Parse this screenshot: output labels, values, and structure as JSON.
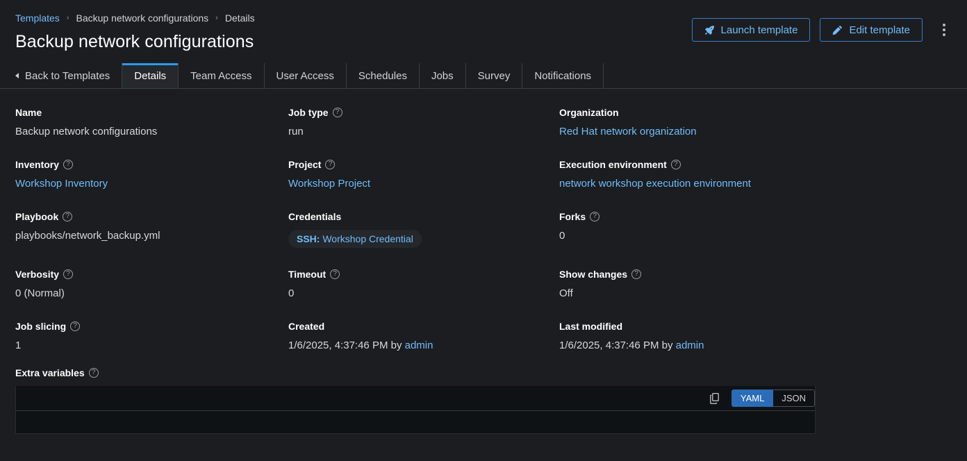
{
  "breadcrumb": {
    "items": [
      {
        "label": "Templates",
        "link": true
      },
      {
        "label": "Backup network configurations",
        "link": false
      },
      {
        "label": "Details",
        "link": false
      }
    ],
    "separator": "›"
  },
  "header": {
    "title": "Backup network configurations",
    "launch_label": "Launch template",
    "edit_label": "Edit template",
    "launch_icon": "rocket-icon",
    "edit_icon": "pencil-icon",
    "kebab_icon": "kebab-menu-icon"
  },
  "tabs": {
    "back_label": "Back to Templates",
    "items": [
      {
        "label": "Details",
        "active": true
      },
      {
        "label": "Team Access",
        "active": false
      },
      {
        "label": "User Access",
        "active": false
      },
      {
        "label": "Schedules",
        "active": false
      },
      {
        "label": "Jobs",
        "active": false
      },
      {
        "label": "Survey",
        "active": false
      },
      {
        "label": "Notifications",
        "active": false
      }
    ]
  },
  "details": {
    "name": {
      "label": "Name",
      "value": "Backup network configurations"
    },
    "job_type": {
      "label": "Job type",
      "value": "run"
    },
    "organization": {
      "label": "Organization",
      "value": "Red Hat network organization"
    },
    "inventory": {
      "label": "Inventory",
      "value": "Workshop Inventory"
    },
    "project": {
      "label": "Project",
      "value": "Workshop Project"
    },
    "execution_environment": {
      "label": "Execution environment",
      "value": "network workshop execution environment"
    },
    "playbook": {
      "label": "Playbook",
      "value": "playbooks/network_backup.yml"
    },
    "credentials": {
      "label": "Credentials",
      "chip_type": "SSH:",
      "chip_name": "Workshop Credential"
    },
    "forks": {
      "label": "Forks",
      "value": "0"
    },
    "verbosity": {
      "label": "Verbosity",
      "value": "0 (Normal)"
    },
    "timeout": {
      "label": "Timeout",
      "value": "0"
    },
    "show_changes": {
      "label": "Show changes",
      "value": "Off"
    },
    "job_slicing": {
      "label": "Job slicing",
      "value": "1"
    },
    "created": {
      "label": "Created",
      "timestamp": "1/6/2025, 4:37:46 PM by ",
      "user": "admin"
    },
    "last_modified": {
      "label": "Last modified",
      "timestamp": "1/6/2025, 4:37:46 PM by ",
      "user": "admin"
    }
  },
  "extra_variables": {
    "label": "Extra variables",
    "content": "",
    "copy_icon": "copy-icon",
    "format_yaml": "YAML",
    "format_json": "JSON",
    "selected_format": "YAML"
  },
  "colors": {
    "accent_blue": "#2b9af3",
    "link_blue": "#73bcf7",
    "selected_blue": "#2b6cb8",
    "page_bg": "#1b1d21",
    "editor_bg": "#0f1214"
  }
}
